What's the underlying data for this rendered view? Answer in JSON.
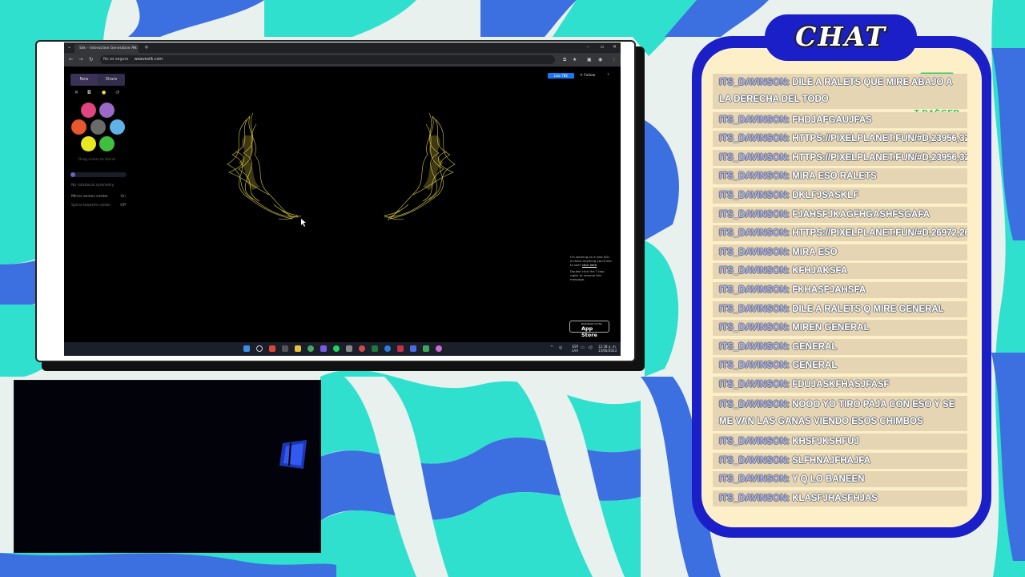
{
  "browser": {
    "tab_title": "Silk – Interactive Generative Art",
    "security_label": "No es seguro",
    "url": "weavesilk.com"
  },
  "silk": {
    "new_label": "New",
    "share_label": "Share",
    "drag_hint": "Drag colors to blend",
    "symmetry_label": "No rotational symmetry",
    "options": [
      {
        "label": "Mirror across center",
        "value": "On"
      },
      {
        "label": "Spiral towards center",
        "value": "Off"
      }
    ],
    "like_label": "Like 78K",
    "follow_label": "Follow",
    "help_label": "?",
    "notice_text": "I'm working on a new Silk. Is there anything you'd like to see?",
    "notice_link": "click here",
    "notice_hint": "Double click the ? (top right) to remove this message.",
    "appstore_small": "Download on the",
    "appstore_big": "App Store",
    "swatch_colors": [
      "#e0457f",
      "#9b6ac9",
      "#e8572d",
      "#6a6a6a",
      "#5fb3e8",
      "#e8e820",
      "#3fbf3f"
    ]
  },
  "taskbar": {
    "lang": "ESP",
    "lang_sub": "LAA",
    "time": "12:38 a. m.",
    "date": "15/06/2023"
  },
  "chat": {
    "title": "CHAT",
    "brand": "T-DAGGER",
    "messages": [
      {
        "user": "ITS_DAVINSON:",
        "text": " DILE A RALETS QUE MIRE ABAJO A LA DERECHA DEL TODO"
      },
      {
        "user": "ITS_DAVINSON:",
        "text": " FHDJAFGAUJFAS"
      },
      {
        "user": "ITS_DAVINSON:",
        "text": " HTTPS://PIXELPLANET.FUN/#D,23956,32338,-5"
      },
      {
        "user": "ITS_DAVINSON:",
        "text": " HTTPS://PIXELPLANET.FUN/#D,23956,32338,-5"
      },
      {
        "user": "ITS_DAVINSON:",
        "text": " MIRA ESO RALETS"
      },
      {
        "user": "ITS_DAVINSON:",
        "text": " DKLFJSASKLF"
      },
      {
        "user": "ITS_DAVINSON:",
        "text": " FJAHSFJKAGFHGASHFSGAFA"
      },
      {
        "user": "ITS_DAVINSON:",
        "text": " HTTPS://PIXELPLANET.FUN/#D,26972,26670,-9"
      },
      {
        "user": "ITS_DAVINSON:",
        "text": " MIRA ESO"
      },
      {
        "user": "ITS_DAVINSON:",
        "text": " KFHJAKSFA"
      },
      {
        "user": "ITS_DAVINSON:",
        "text": " FKHASFJAHSFA"
      },
      {
        "user": "ITS_DAVINSON:",
        "text": " DILE A RALETS Q MIRE GENERAL"
      },
      {
        "user": "ITS_DAVINSON:",
        "text": " MIREN GENERAL"
      },
      {
        "user": "ITS_DAVINSON:",
        "text": " GENERAL"
      },
      {
        "user": "ITS_DAVINSON:",
        "text": " GENERAL"
      },
      {
        "user": "ITS_DAVINSON:",
        "text": " FDUJASKFHASJFASF"
      },
      {
        "user": "ITS_DAVINSON:",
        "text": " NOOO YO TIRO PAJA CON ESO Y SE ME VAN LAS GANAS VIENDO ESOS CHIMBOS"
      },
      {
        "user": "ITS_DAVINSON:",
        "text": " KHSFJKSHFUJ"
      },
      {
        "user": "ITS_DAVINSON:",
        "text": " SLFHNAJFHAJFA"
      },
      {
        "user": "ITS_DAVINSON:",
        "text": " Y Q LO BANEEN"
      },
      {
        "user": "ITS_DAVINSON:",
        "text": " KLASFJHASFHJAS"
      }
    ]
  }
}
